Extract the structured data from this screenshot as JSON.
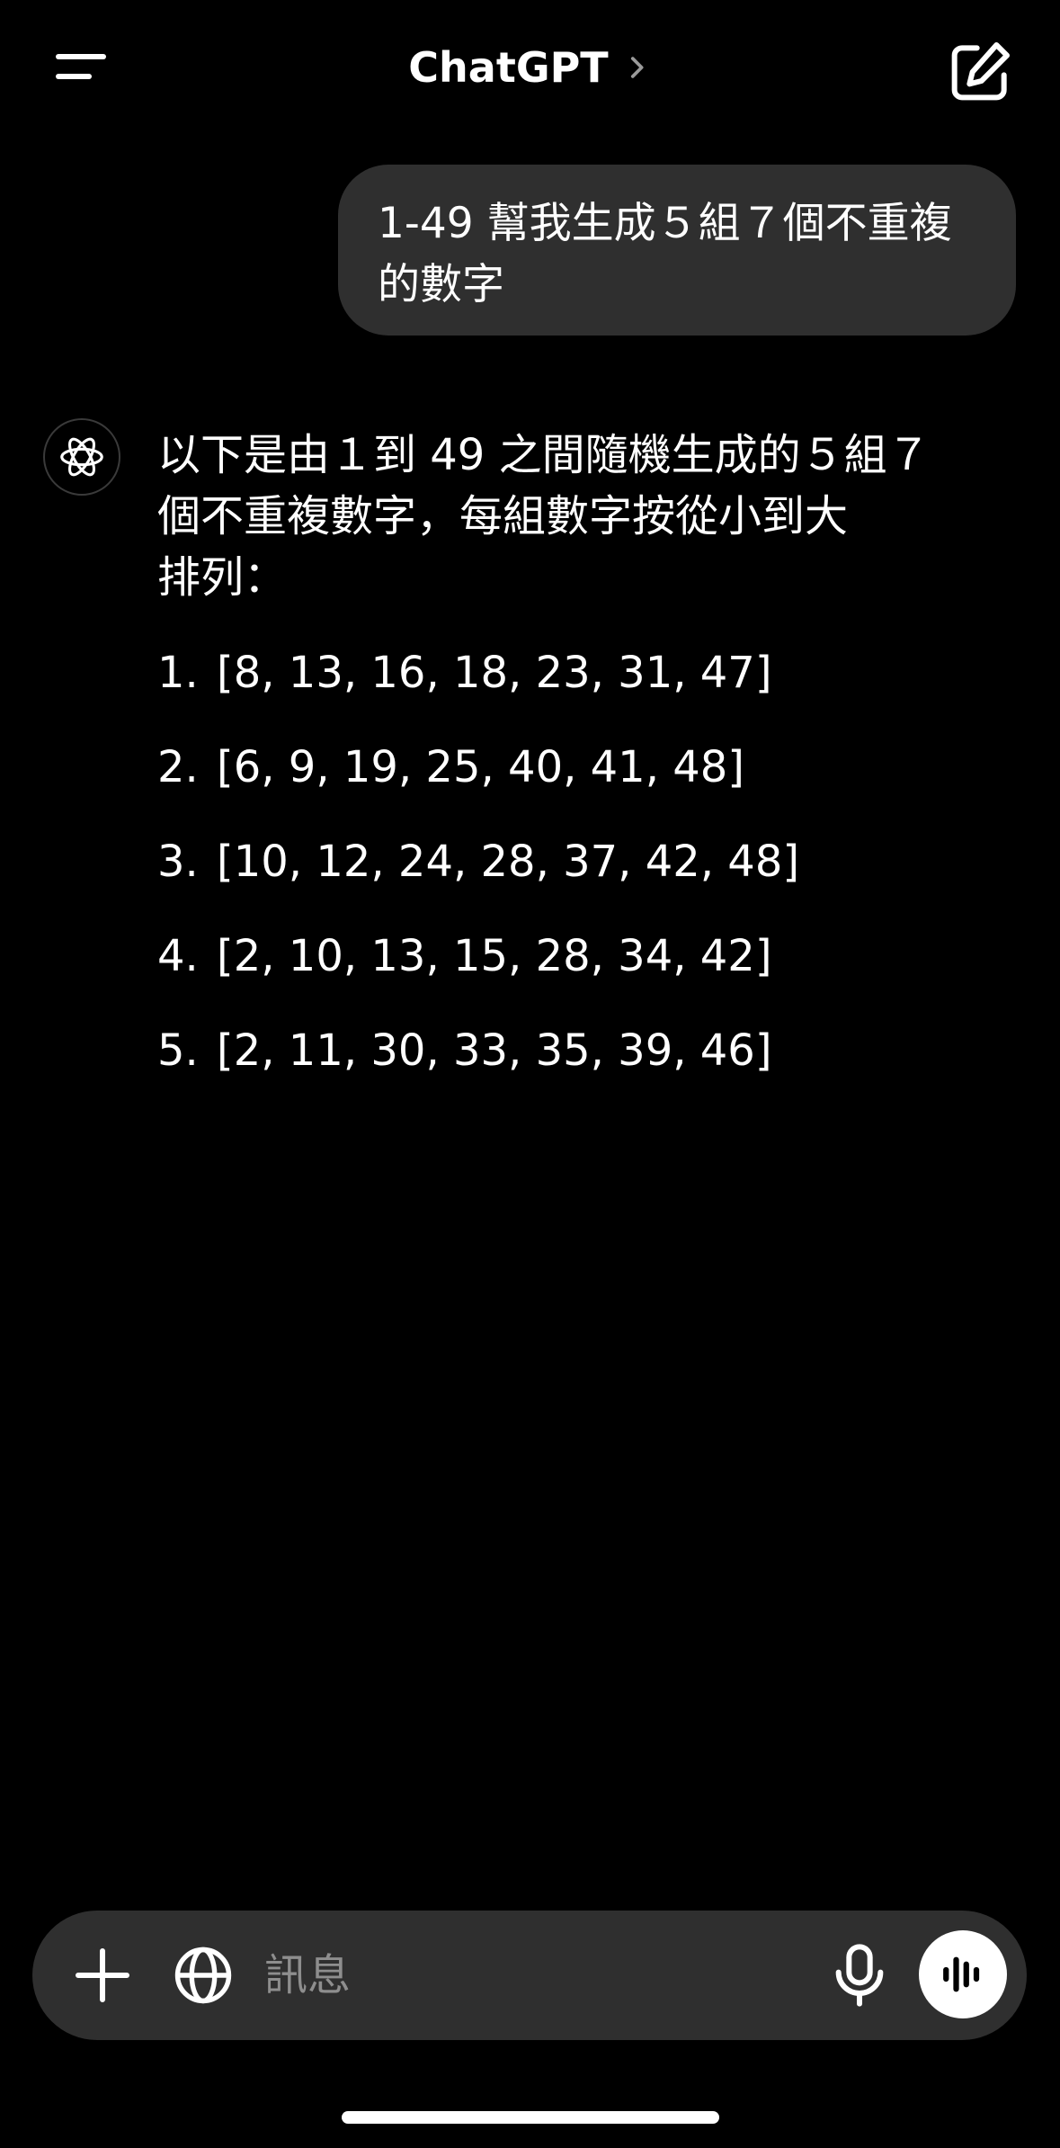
{
  "header": {
    "title": "ChatGPT",
    "menu_icon": "menu-icon",
    "chevron_icon": "chevron-right-icon",
    "compose_icon": "new-chat-icon"
  },
  "conversation": {
    "user_message": {
      "line1": "1-49 幫我生成５組７個不重複",
      "line2": "的數字"
    },
    "assistant_message": {
      "avatar_icon": "openai-logo-icon",
      "intro_line1": "以下是由１到 49 之間隨機生成的５組７",
      "intro_line2": "個不重複數字，每組數字按從小到大",
      "intro_line3": "排列：",
      "items": [
        {
          "num": "1.",
          "text": "[8, 13, 16, 18, 23, 31, 47]"
        },
        {
          "num": "2.",
          "text": "[6, 9, 19, 25, 40, 41, 48]"
        },
        {
          "num": "3.",
          "text": "[10, 12, 24, 28, 37, 42, 48]"
        },
        {
          "num": "4.",
          "text": "[2, 10, 13, 15, 28, 34, 42]"
        },
        {
          "num": "5.",
          "text": "[2, 11, 30, 33, 35, 39, 46]"
        }
      ]
    }
  },
  "composer": {
    "placeholder": "訊息",
    "plus_icon": "plus-icon",
    "globe_icon": "globe-icon",
    "mic_icon": "microphone-icon",
    "voice_icon": "voice-mode-icon"
  },
  "colors": {
    "background": "#000000",
    "bubble": "#2f2f2f",
    "text": "#ffffff",
    "placeholder": "#8e8e8e"
  }
}
